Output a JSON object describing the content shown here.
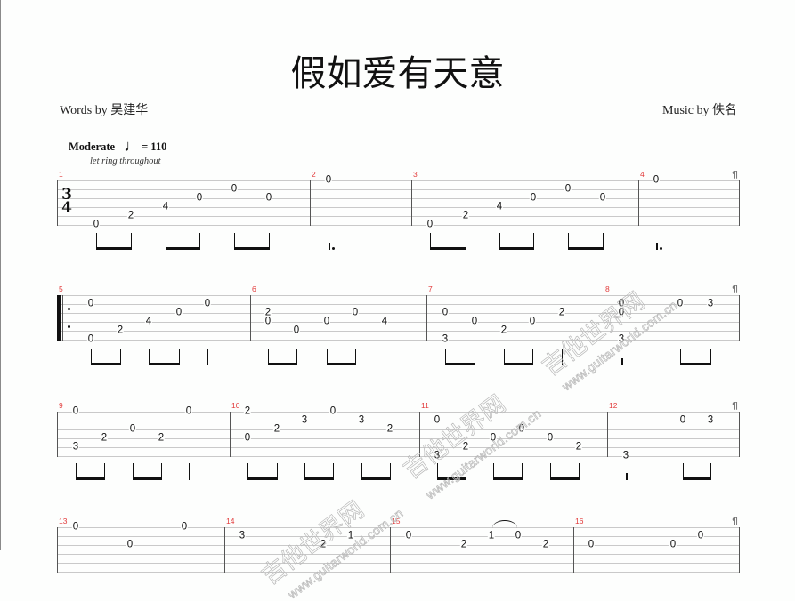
{
  "page": {
    "title": "假如爱有天意",
    "words_by": "Words by 吴建华",
    "music_by": "Music by 佚名"
  },
  "tempo": {
    "marking": "Moderate",
    "note_symbol": "♩",
    "bpm_text": "= 110",
    "bpm": 110
  },
  "instruction": "let ring throughout",
  "time_signature": {
    "numerator": "3",
    "denominator": "4"
  },
  "end_of_system_symbol": "¶",
  "watermark": {
    "site_name": "吉他世界网",
    "url": "www.guitarworld.com.cn"
  },
  "colors": {
    "measure_number": "#e23b3b",
    "staff_line": "#c9c9c9",
    "barline": "#555555",
    "note": "#111111",
    "watermark": "#b9b9b9"
  },
  "systems": [
    {
      "repeat_start": false,
      "time_signature": true,
      "measures": [
        {
          "number": "1",
          "events": [
            {
              "duration": "eighth",
              "beam": "start",
              "notes": [
                {
                  "string": 6,
                  "fret": "0"
                }
              ]
            },
            {
              "duration": "eighth",
              "beam": "end",
              "notes": [
                {
                  "string": 5,
                  "fret": "2"
                }
              ]
            },
            {
              "duration": "eighth",
              "beam": "start",
              "notes": [
                {
                  "string": 4,
                  "fret": "4"
                }
              ]
            },
            {
              "duration": "eighth",
              "beam": "end",
              "notes": [
                {
                  "string": 3,
                  "fret": "0"
                }
              ]
            },
            {
              "duration": "eighth",
              "beam": "start",
              "notes": [
                {
                  "string": 2,
                  "fret": "0"
                }
              ]
            },
            {
              "duration": "eighth",
              "beam": "end",
              "notes": [
                {
                  "string": 3,
                  "fret": "0"
                }
              ]
            }
          ]
        },
        {
          "number": "2",
          "events": [
            {
              "duration": "dotted-half",
              "notes": [
                {
                  "string": 1,
                  "fret": "0"
                }
              ]
            }
          ]
        },
        {
          "number": "3",
          "events": [
            {
              "duration": "eighth",
              "beam": "start",
              "notes": [
                {
                  "string": 6,
                  "fret": "0"
                }
              ]
            },
            {
              "duration": "eighth",
              "beam": "end",
              "notes": [
                {
                  "string": 5,
                  "fret": "2"
                }
              ]
            },
            {
              "duration": "eighth",
              "beam": "start",
              "notes": [
                {
                  "string": 4,
                  "fret": "4"
                }
              ]
            },
            {
              "duration": "eighth",
              "beam": "end",
              "notes": [
                {
                  "string": 3,
                  "fret": "0"
                }
              ]
            },
            {
              "duration": "eighth",
              "beam": "start",
              "notes": [
                {
                  "string": 2,
                  "fret": "0"
                }
              ]
            },
            {
              "duration": "eighth",
              "beam": "end",
              "notes": [
                {
                  "string": 3,
                  "fret": "0"
                }
              ]
            }
          ]
        },
        {
          "number": "4",
          "events": [
            {
              "duration": "dotted-half",
              "notes": [
                {
                  "string": 1,
                  "fret": "0"
                }
              ]
            }
          ]
        }
      ]
    },
    {
      "repeat_start": true,
      "time_signature": false,
      "measures": [
        {
          "number": "5",
          "events": [
            {
              "duration": "eighth",
              "beam": "start",
              "notes": [
                {
                  "string": 2,
                  "fret": "0"
                },
                {
                  "string": 6,
                  "fret": "0"
                }
              ]
            },
            {
              "duration": "eighth",
              "beam": "end",
              "notes": [
                {
                  "string": 5,
                  "fret": "2"
                }
              ]
            },
            {
              "duration": "eighth",
              "beam": "start",
              "notes": [
                {
                  "string": 4,
                  "fret": "4"
                }
              ]
            },
            {
              "duration": "eighth",
              "beam": "end",
              "notes": [
                {
                  "string": 3,
                  "fret": "0"
                }
              ]
            },
            {
              "duration": "quarter",
              "notes": [
                {
                  "string": 2,
                  "fret": "0"
                }
              ]
            }
          ]
        },
        {
          "number": "6",
          "events": [
            {
              "duration": "eighth",
              "beam": "start",
              "notes": [
                {
                  "string": 3,
                  "fret": "2"
                },
                {
                  "string": 4,
                  "fret": "0"
                }
              ]
            },
            {
              "duration": "eighth",
              "beam": "end",
              "notes": [
                {
                  "string": 5,
                  "fret": "0"
                }
              ]
            },
            {
              "duration": "eighth",
              "beam": "start",
              "notes": [
                {
                  "string": 4,
                  "fret": "0"
                }
              ]
            },
            {
              "duration": "eighth",
              "beam": "end",
              "notes": [
                {
                  "string": 3,
                  "fret": "0"
                }
              ]
            },
            {
              "duration": "quarter",
              "notes": [
                {
                  "string": 4,
                  "fret": "4"
                }
              ]
            }
          ]
        },
        {
          "number": "7",
          "events": [
            {
              "duration": "eighth",
              "beam": "start",
              "notes": [
                {
                  "string": 3,
                  "fret": "0"
                },
                {
                  "string": 6,
                  "fret": "3"
                }
              ]
            },
            {
              "duration": "eighth",
              "beam": "end",
              "notes": [
                {
                  "string": 4,
                  "fret": "0"
                }
              ]
            },
            {
              "duration": "eighth",
              "beam": "start",
              "notes": [
                {
                  "string": 5,
                  "fret": "2"
                }
              ]
            },
            {
              "duration": "eighth",
              "beam": "end",
              "notes": [
                {
                  "string": 4,
                  "fret": "0"
                }
              ]
            },
            {
              "duration": "quarter",
              "notes": [
                {
                  "string": 3,
                  "fret": "2"
                }
              ]
            }
          ]
        },
        {
          "number": "8",
          "events": [
            {
              "duration": "half",
              "notes": [
                {
                  "string": 2,
                  "fret": "0"
                },
                {
                  "string": 3,
                  "fret": "0"
                },
                {
                  "string": 6,
                  "fret": "3"
                }
              ]
            },
            {
              "duration": "eighth",
              "beam": "start",
              "notes": [
                {
                  "string": 2,
                  "fret": "0"
                }
              ]
            },
            {
              "duration": "eighth",
              "beam": "end",
              "notes": [
                {
                  "string": 2,
                  "fret": "3"
                }
              ]
            }
          ]
        }
      ]
    },
    {
      "repeat_start": false,
      "time_signature": false,
      "measures": [
        {
          "number": "9",
          "events": [
            {
              "duration": "eighth",
              "beam": "start",
              "notes": [
                {
                  "string": 1,
                  "fret": "0"
                },
                {
                  "string": 5,
                  "fret": "3"
                }
              ]
            },
            {
              "duration": "eighth",
              "beam": "end",
              "notes": [
                {
                  "string": 4,
                  "fret": "2"
                }
              ]
            },
            {
              "duration": "eighth",
              "beam": "start",
              "notes": [
                {
                  "string": 3,
                  "fret": "0"
                }
              ]
            },
            {
              "duration": "eighth",
              "beam": "end",
              "notes": [
                {
                  "string": 4,
                  "fret": "2"
                }
              ]
            },
            {
              "duration": "quarter",
              "notes": [
                {
                  "string": 1,
                  "fret": "0"
                }
              ]
            }
          ]
        },
        {
          "number": "10",
          "events": [
            {
              "duration": "eighth",
              "beam": "start",
              "notes": [
                {
                  "string": 1,
                  "fret": "2"
                },
                {
                  "string": 4,
                  "fret": "0"
                }
              ]
            },
            {
              "duration": "eighth",
              "beam": "end",
              "notes": [
                {
                  "string": 3,
                  "fret": "2"
                }
              ]
            },
            {
              "duration": "eighth",
              "beam": "start",
              "notes": [
                {
                  "string": 2,
                  "fret": "3"
                }
              ]
            },
            {
              "duration": "eighth",
              "beam": "end",
              "notes": [
                {
                  "string": 1,
                  "fret": "0"
                }
              ]
            },
            {
              "duration": "eighth",
              "beam": "start",
              "notes": [
                {
                  "string": 2,
                  "fret": "3"
                }
              ]
            },
            {
              "duration": "eighth",
              "beam": "end",
              "notes": [
                {
                  "string": 3,
                  "fret": "2"
                }
              ]
            }
          ]
        },
        {
          "number": "11",
          "events": [
            {
              "duration": "eighth",
              "beam": "start",
              "notes": [
                {
                  "string": 2,
                  "fret": "0"
                },
                {
                  "string": 6,
                  "fret": "3"
                }
              ]
            },
            {
              "duration": "eighth",
              "beam": "end",
              "notes": [
                {
                  "string": 5,
                  "fret": "2"
                }
              ]
            },
            {
              "duration": "eighth",
              "beam": "start",
              "notes": [
                {
                  "string": 4,
                  "fret": "0"
                }
              ]
            },
            {
              "duration": "eighth",
              "beam": "end",
              "notes": [
                {
                  "string": 3,
                  "fret": "0"
                }
              ]
            },
            {
              "duration": "eighth",
              "beam": "start",
              "notes": [
                {
                  "string": 4,
                  "fret": "0"
                }
              ]
            },
            {
              "duration": "eighth",
              "beam": "end",
              "notes": [
                {
                  "string": 5,
                  "fret": "2"
                }
              ]
            }
          ]
        },
        {
          "number": "12",
          "events": [
            {
              "duration": "half",
              "notes": [
                {
                  "string": 6,
                  "fret": "3"
                }
              ]
            },
            {
              "duration": "eighth",
              "beam": "start",
              "notes": [
                {
                  "string": 2,
                  "fret": "0"
                }
              ]
            },
            {
              "duration": "eighth",
              "beam": "end",
              "notes": [
                {
                  "string": 2,
                  "fret": "3"
                }
              ]
            }
          ]
        }
      ]
    },
    {
      "repeat_start": false,
      "time_signature": false,
      "measures": [
        {
          "number": "13",
          "events": [
            {
              "notes": [
                {
                  "string": 1,
                  "fret": "0"
                }
              ]
            },
            {
              "notes": [
                {
                  "string": 3,
                  "fret": "0"
                }
              ]
            },
            {
              "notes": [
                {
                  "string": 1,
                  "fret": "0"
                }
              ]
            }
          ]
        },
        {
          "number": "14",
          "events": [
            {
              "notes": [
                {
                  "string": 2,
                  "fret": "3"
                }
              ]
            },
            {
              "notes": [
                {
                  "string": 3,
                  "fret": "2"
                }
              ]
            },
            {
              "notes": [
                {
                  "string": 2,
                  "fret": "1"
                }
              ]
            }
          ]
        },
        {
          "number": "15",
          "events": [
            {
              "notes": [
                {
                  "string": 2,
                  "fret": "0"
                }
              ]
            },
            {
              "notes": [
                {
                  "string": 3,
                  "fret": "2"
                }
              ]
            },
            {
              "notes": [
                {
                  "string": 2,
                  "fret": "1"
                }
              ],
              "slur_to_next": true
            },
            {
              "notes": [
                {
                  "string": 2,
                  "fret": "0"
                }
              ]
            },
            {
              "notes": [
                {
                  "string": 3,
                  "fret": "2"
                }
              ]
            }
          ]
        },
        {
          "number": "16",
          "events": [
            {
              "notes": [
                {
                  "string": 3,
                  "fret": "0"
                }
              ]
            },
            {
              "notes": [
                {
                  "string": 3,
                  "fret": "0"
                }
              ]
            },
            {
              "notes": [
                {
                  "string": 2,
                  "fret": "0"
                }
              ]
            }
          ]
        }
      ]
    }
  ]
}
